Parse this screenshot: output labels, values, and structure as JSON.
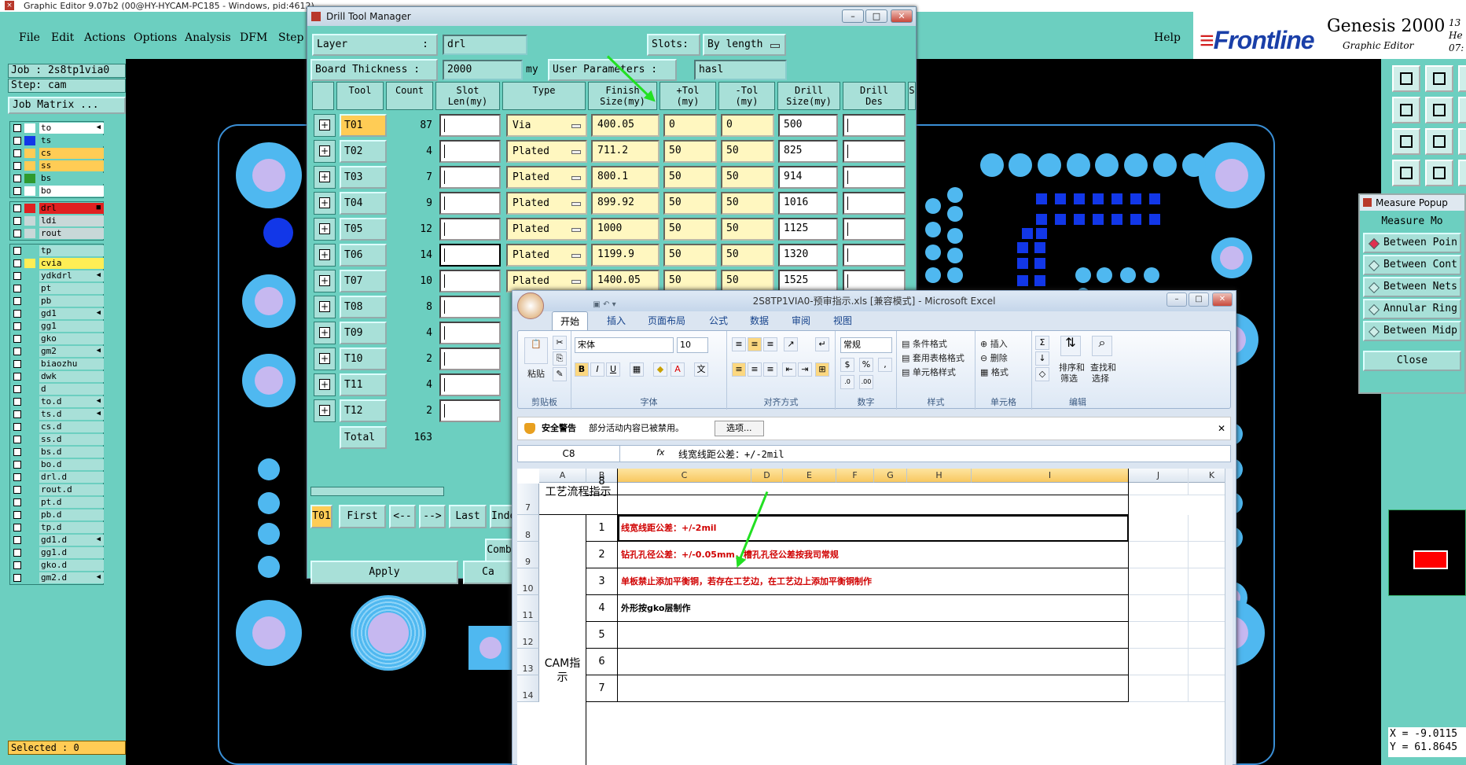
{
  "main_window": {
    "title": "Graphic Editor 9.07b2 (00@HY-HYCAM-PC185 - Windows, pid:4612)",
    "menus": [
      "File",
      "Edit",
      "Actions",
      "Options",
      "Analysis",
      "DFM",
      "Step"
    ],
    "help": "Help",
    "brand": {
      "logo": "Frontline",
      "product": "Genesis 2000",
      "subtitle": "Graphic Editor",
      "date_line1": "13 He",
      "date_line2": "07:"
    },
    "job_label": "Job : 2s8tp1via0",
    "step_label": "Step: cam",
    "job_matrix": "Job Matrix ...",
    "selected_label": "Selected : 0"
  },
  "layers_group1": [
    {
      "name": "to",
      "color": "#ffffff",
      "mark": "◀"
    },
    {
      "name": "ts",
      "color": "#1237e8",
      "mark": ""
    },
    {
      "name": "cs",
      "color": "#ffcc55",
      "mark": ""
    },
    {
      "name": "ss",
      "color": "#ffcc55",
      "mark": ""
    },
    {
      "name": "bs",
      "color": "#2e9a2e",
      "mark": ""
    },
    {
      "name": "bo",
      "color": "#ffffff",
      "mark": ""
    }
  ],
  "layers_group2": [
    {
      "name": "drl",
      "color": "#e02020",
      "mark": "■"
    },
    {
      "name": "ldi",
      "color": "#c8d8d8",
      "mark": ""
    },
    {
      "name": "rout",
      "color": "#c8d8d8",
      "mark": ""
    }
  ],
  "layers_group3": [
    {
      "name": "tp",
      "color": "",
      "mark": ""
    },
    {
      "name": "cvia",
      "color": "#ffee55",
      "mark": ""
    },
    {
      "name": "ydkdrl",
      "color": "",
      "mark": "◀"
    },
    {
      "name": "pt",
      "color": "",
      "mark": ""
    },
    {
      "name": "pb",
      "color": "",
      "mark": ""
    },
    {
      "name": "gd1",
      "color": "",
      "mark": "◀"
    },
    {
      "name": "gg1",
      "color": "",
      "mark": ""
    },
    {
      "name": "gko",
      "color": "",
      "mark": ""
    },
    {
      "name": "gm2",
      "color": "",
      "mark": "◀"
    },
    {
      "name": "biaozhu",
      "color": "",
      "mark": ""
    },
    {
      "name": "dwk",
      "color": "",
      "mark": ""
    },
    {
      "name": "d",
      "color": "",
      "mark": ""
    },
    {
      "name": "to.d",
      "color": "",
      "mark": "◀"
    },
    {
      "name": "ts.d",
      "color": "",
      "mark": "◀"
    },
    {
      "name": "cs.d",
      "color": "",
      "mark": ""
    },
    {
      "name": "ss.d",
      "color": "",
      "mark": ""
    },
    {
      "name": "bs.d",
      "color": "",
      "mark": ""
    },
    {
      "name": "bo.d",
      "color": "",
      "mark": ""
    },
    {
      "name": "drl.d",
      "color": "",
      "mark": ""
    },
    {
      "name": "rout.d",
      "color": "",
      "mark": ""
    },
    {
      "name": "pt.d",
      "color": "",
      "mark": ""
    },
    {
      "name": "pb.d",
      "color": "",
      "mark": ""
    },
    {
      "name": "tp.d",
      "color": "",
      "mark": ""
    },
    {
      "name": "gd1.d",
      "color": "",
      "mark": "◀"
    },
    {
      "name": "gg1.d",
      "color": "",
      "mark": ""
    },
    {
      "name": "gko.d",
      "color": "",
      "mark": ""
    },
    {
      "name": "gm2.d",
      "color": "",
      "mark": "◀"
    }
  ],
  "measure_popup": {
    "title": "Measure Popup",
    "header": "Measure Mo",
    "items": [
      "Between Poin",
      "Between Cont",
      "Between Nets",
      "Annular Ring",
      "Between Midp"
    ],
    "close": "Close"
  },
  "coords": {
    "x": "X = -9.0115",
    "y": "Y = 61.8645"
  },
  "drill_tool_manager": {
    "title": "Drill Tool Manager",
    "layer_label": "Layer",
    "layer_colon": ":",
    "layer_value": "drl",
    "slots_label": "Slots:",
    "slots_value": "By length",
    "board_thickness_label": "Board Thickness :",
    "board_thickness_value": "2000",
    "board_thickness_unit": "my",
    "user_params_label": "User Parameters :",
    "user_params_value": "hasl",
    "headers": [
      "Tool",
      "Count",
      "Slot\nLen(my)",
      "Type",
      "Finish\nSize(my)",
      "+Tol\n(my)",
      "-Tol\n(my)",
      "Drill\nSize(my)",
      "Drill\nDes",
      "S"
    ],
    "rows": [
      {
        "tool": "T01",
        "count": "87",
        "type": "Via",
        "finish": "400.05",
        "ptol": "0",
        "mtol": "0",
        "drill": "500"
      },
      {
        "tool": "T02",
        "count": "4",
        "type": "Plated",
        "finish": "711.2",
        "ptol": "50",
        "mtol": "50",
        "drill": "825"
      },
      {
        "tool": "T03",
        "count": "7",
        "type": "Plated",
        "finish": "800.1",
        "ptol": "50",
        "mtol": "50",
        "drill": "914"
      },
      {
        "tool": "T04",
        "count": "9",
        "type": "Plated",
        "finish": "899.92",
        "ptol": "50",
        "mtol": "50",
        "drill": "1016"
      },
      {
        "tool": "T05",
        "count": "12",
        "type": "Plated",
        "finish": "1000",
        "ptol": "50",
        "mtol": "50",
        "drill": "1125"
      },
      {
        "tool": "T06",
        "count": "14",
        "type": "Plated",
        "finish": "1199.9",
        "ptol": "50",
        "mtol": "50",
        "drill": "1320"
      },
      {
        "tool": "T07",
        "count": "10",
        "type": "Plated",
        "finish": "1400.05",
        "ptol": "50",
        "mtol": "50",
        "drill": "1525"
      },
      {
        "tool": "T08",
        "count": "8",
        "type": "",
        "finish": "",
        "ptol": "",
        "mtol": "",
        "drill": ""
      },
      {
        "tool": "T09",
        "count": "4",
        "type": "",
        "finish": "",
        "ptol": "",
        "mtol": "",
        "drill": ""
      },
      {
        "tool": "T10",
        "count": "2",
        "type": "",
        "finish": "",
        "ptol": "",
        "mtol": "",
        "drill": ""
      },
      {
        "tool": "T11",
        "count": "4",
        "type": "",
        "finish": "",
        "ptol": "",
        "mtol": "",
        "drill": ""
      },
      {
        "tool": "T12",
        "count": "2",
        "type": "",
        "finish": "",
        "ptol": "",
        "mtol": "",
        "drill": ""
      }
    ],
    "total_label": "Total",
    "total_value": "163",
    "nav": {
      "current": "T01",
      "first": "First",
      "prev": "<--",
      "next": "-->",
      "last": "Last",
      "index": "Inde"
    },
    "comb": "Comb",
    "apply": "Apply",
    "ca": "Ca"
  },
  "excel": {
    "title": "2S8TP1VIA0-预审指示.xls  [兼容模式] - Microsoft Excel",
    "tabs": [
      "开始",
      "插入",
      "页面布局",
      "公式",
      "数据",
      "审阅",
      "视图"
    ],
    "groups": [
      "剪贴板",
      "字体",
      "对齐方式",
      "数字",
      "样式",
      "单元格",
      "编辑"
    ],
    "paste": "粘贴",
    "font_name": "宋体",
    "font_size": "10",
    "number_format": "常规",
    "style_items": [
      "条件格式",
      "套用表格格式",
      "单元格样式"
    ],
    "cell_items": [
      "插入",
      "删除",
      "格式"
    ],
    "edit_items": [
      "排序和",
      "筛选",
      "查找和",
      "选择"
    ],
    "security_warning": "安全警告",
    "warning_text": "部分活动内容已被禁用。",
    "options_button": "选项...",
    "name_box": "C8",
    "fx": "fx",
    "formula": "线宽线距公差：+/-2mil",
    "columns": [
      "A",
      "B",
      "C",
      "D",
      "E",
      "F",
      "G",
      "H",
      "I",
      "J",
      "K"
    ],
    "row7_label": "工艺流程指示",
    "cam_label": "CAM指示",
    "row_numbers": [
      "7",
      "8",
      "9",
      "10",
      "11",
      "12",
      "13",
      "14"
    ],
    "items": [
      {
        "no": "1",
        "text": "线宽线距公差：+/-2mil",
        "red": true
      },
      {
        "no": "2",
        "text": "钻孔孔径公差：+/-0.05mm，槽孔孔径公差按我司常规",
        "red": true
      },
      {
        "no": "3",
        "text": "单板禁止添加平衡铜，若存在工艺边，在工艺边上添加平衡铜制作",
        "red": true
      },
      {
        "no": "4",
        "text": "外形按gko层制作",
        "red": false
      },
      {
        "no": "5",
        "text": "",
        "red": false
      },
      {
        "no": "6",
        "text": "",
        "red": false
      },
      {
        "no": "7",
        "text": "",
        "red": false
      },
      {
        "no": "8",
        "text": "",
        "red": false
      }
    ]
  },
  "colors": {
    "panel": "#6ccfc0",
    "field": "#a8e0d8",
    "pad": "#4fb8f0",
    "hole": "#c6b8f0",
    "smd": "#1237e8",
    "arrow": "#22e022"
  }
}
